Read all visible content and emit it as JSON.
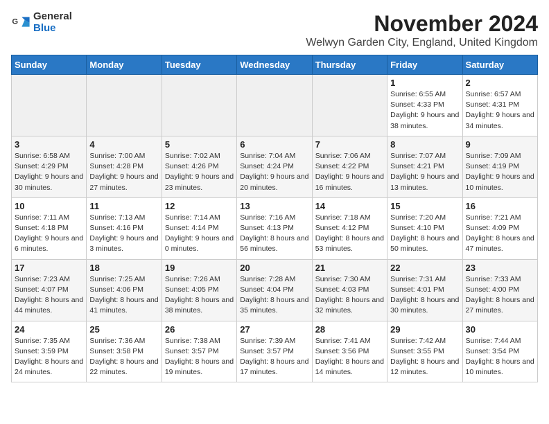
{
  "logo": {
    "general": "General",
    "blue": "Blue"
  },
  "title": "November 2024",
  "subtitle": "Welwyn Garden City, England, United Kingdom",
  "days_of_week": [
    "Sunday",
    "Monday",
    "Tuesday",
    "Wednesday",
    "Thursday",
    "Friday",
    "Saturday"
  ],
  "weeks": [
    [
      {
        "day": "",
        "info": ""
      },
      {
        "day": "",
        "info": ""
      },
      {
        "day": "",
        "info": ""
      },
      {
        "day": "",
        "info": ""
      },
      {
        "day": "",
        "info": ""
      },
      {
        "day": "1",
        "info": "Sunrise: 6:55 AM\nSunset: 4:33 PM\nDaylight: 9 hours and 38 minutes."
      },
      {
        "day": "2",
        "info": "Sunrise: 6:57 AM\nSunset: 4:31 PM\nDaylight: 9 hours and 34 minutes."
      }
    ],
    [
      {
        "day": "3",
        "info": "Sunrise: 6:58 AM\nSunset: 4:29 PM\nDaylight: 9 hours and 30 minutes."
      },
      {
        "day": "4",
        "info": "Sunrise: 7:00 AM\nSunset: 4:28 PM\nDaylight: 9 hours and 27 minutes."
      },
      {
        "day": "5",
        "info": "Sunrise: 7:02 AM\nSunset: 4:26 PM\nDaylight: 9 hours and 23 minutes."
      },
      {
        "day": "6",
        "info": "Sunrise: 7:04 AM\nSunset: 4:24 PM\nDaylight: 9 hours and 20 minutes."
      },
      {
        "day": "7",
        "info": "Sunrise: 7:06 AM\nSunset: 4:22 PM\nDaylight: 9 hours and 16 minutes."
      },
      {
        "day": "8",
        "info": "Sunrise: 7:07 AM\nSunset: 4:21 PM\nDaylight: 9 hours and 13 minutes."
      },
      {
        "day": "9",
        "info": "Sunrise: 7:09 AM\nSunset: 4:19 PM\nDaylight: 9 hours and 10 minutes."
      }
    ],
    [
      {
        "day": "10",
        "info": "Sunrise: 7:11 AM\nSunset: 4:18 PM\nDaylight: 9 hours and 6 minutes."
      },
      {
        "day": "11",
        "info": "Sunrise: 7:13 AM\nSunset: 4:16 PM\nDaylight: 9 hours and 3 minutes."
      },
      {
        "day": "12",
        "info": "Sunrise: 7:14 AM\nSunset: 4:14 PM\nDaylight: 9 hours and 0 minutes."
      },
      {
        "day": "13",
        "info": "Sunrise: 7:16 AM\nSunset: 4:13 PM\nDaylight: 8 hours and 56 minutes."
      },
      {
        "day": "14",
        "info": "Sunrise: 7:18 AM\nSunset: 4:12 PM\nDaylight: 8 hours and 53 minutes."
      },
      {
        "day": "15",
        "info": "Sunrise: 7:20 AM\nSunset: 4:10 PM\nDaylight: 8 hours and 50 minutes."
      },
      {
        "day": "16",
        "info": "Sunrise: 7:21 AM\nSunset: 4:09 PM\nDaylight: 8 hours and 47 minutes."
      }
    ],
    [
      {
        "day": "17",
        "info": "Sunrise: 7:23 AM\nSunset: 4:07 PM\nDaylight: 8 hours and 44 minutes."
      },
      {
        "day": "18",
        "info": "Sunrise: 7:25 AM\nSunset: 4:06 PM\nDaylight: 8 hours and 41 minutes."
      },
      {
        "day": "19",
        "info": "Sunrise: 7:26 AM\nSunset: 4:05 PM\nDaylight: 8 hours and 38 minutes."
      },
      {
        "day": "20",
        "info": "Sunrise: 7:28 AM\nSunset: 4:04 PM\nDaylight: 8 hours and 35 minutes."
      },
      {
        "day": "21",
        "info": "Sunrise: 7:30 AM\nSunset: 4:03 PM\nDaylight: 8 hours and 32 minutes."
      },
      {
        "day": "22",
        "info": "Sunrise: 7:31 AM\nSunset: 4:01 PM\nDaylight: 8 hours and 30 minutes."
      },
      {
        "day": "23",
        "info": "Sunrise: 7:33 AM\nSunset: 4:00 PM\nDaylight: 8 hours and 27 minutes."
      }
    ],
    [
      {
        "day": "24",
        "info": "Sunrise: 7:35 AM\nSunset: 3:59 PM\nDaylight: 8 hours and 24 minutes."
      },
      {
        "day": "25",
        "info": "Sunrise: 7:36 AM\nSunset: 3:58 PM\nDaylight: 8 hours and 22 minutes."
      },
      {
        "day": "26",
        "info": "Sunrise: 7:38 AM\nSunset: 3:57 PM\nDaylight: 8 hours and 19 minutes."
      },
      {
        "day": "27",
        "info": "Sunrise: 7:39 AM\nSunset: 3:57 PM\nDaylight: 8 hours and 17 minutes."
      },
      {
        "day": "28",
        "info": "Sunrise: 7:41 AM\nSunset: 3:56 PM\nDaylight: 8 hours and 14 minutes."
      },
      {
        "day": "29",
        "info": "Sunrise: 7:42 AM\nSunset: 3:55 PM\nDaylight: 8 hours and 12 minutes."
      },
      {
        "day": "30",
        "info": "Sunrise: 7:44 AM\nSunset: 3:54 PM\nDaylight: 8 hours and 10 minutes."
      }
    ]
  ]
}
